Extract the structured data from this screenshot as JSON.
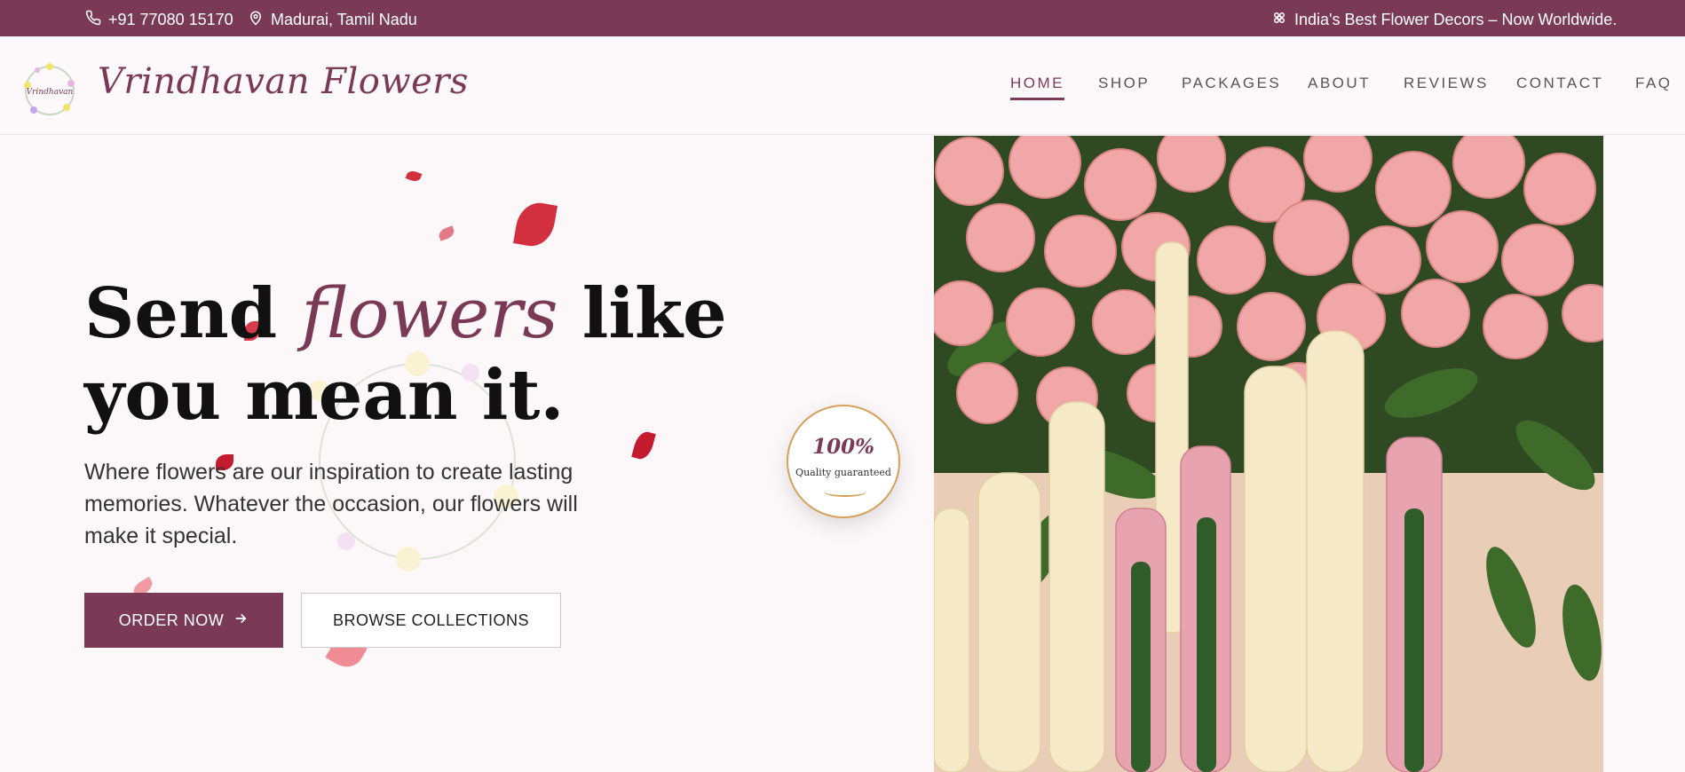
{
  "topbar": {
    "phone": "+91 77080 15170",
    "location": "Madurai, Tamil Nadu",
    "tagline": "India's Best Flower Decors – Now Worldwide."
  },
  "header": {
    "brand": "Vrindhavan Flowers",
    "nav": [
      "HOME",
      "SHOP",
      "PACKAGES",
      "ABOUT",
      "REVIEWS",
      "CONTACT",
      "FAQ"
    ],
    "active_nav": "HOME"
  },
  "hero": {
    "title_part1": "Send ",
    "title_accent": "flowers",
    "title_part2": " like you mean it.",
    "subtitle": "Where flowers are our inspiration to create lasting memories. Whatever the occasion, our flowers will make it special.",
    "order_button": "ORDER NOW",
    "browse_button": "BROWSE COLLECTIONS"
  },
  "quality_badge": {
    "percent": "100%",
    "label": "Quality guaranteed"
  },
  "colors": {
    "brand": "#7a3a55",
    "badge_gold": "#d4a05a"
  }
}
